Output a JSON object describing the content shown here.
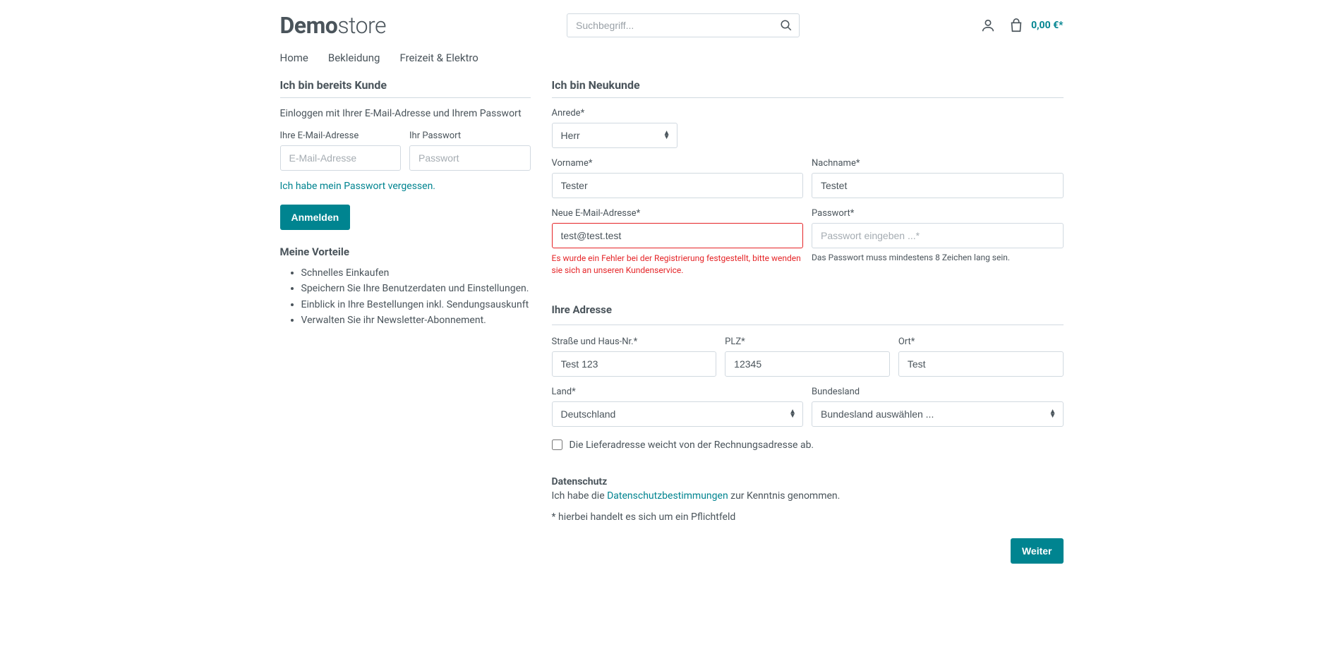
{
  "header": {
    "logo_bold": "Demo",
    "logo_light": "store",
    "search_placeholder": "Suchbegriff...",
    "cart_total": "0,00 €*"
  },
  "nav": {
    "items": [
      "Home",
      "Bekleidung",
      "Freizeit & Elektro"
    ]
  },
  "login": {
    "title": "Ich bin bereits Kunde",
    "desc": "Einloggen mit Ihrer E-Mail-Adresse und Ihrem Passwort",
    "email_label": "Ihre E-Mail-Adresse",
    "email_placeholder": "E-Mail-Adresse",
    "password_label": "Ihr Passwort",
    "password_placeholder": "Passwort",
    "forgot_link": "Ich habe mein Passwort vergessen.",
    "submit": "Anmelden"
  },
  "advantages": {
    "title": "Meine Vorteile",
    "items": [
      "Schnelles Einkaufen",
      "Speichern Sie Ihre Benutzerdaten und Einstellungen.",
      "Einblick in Ihre Bestellungen inkl. Sendungsauskunft",
      "Verwalten Sie ihr Newsletter-Abonnement."
    ]
  },
  "register": {
    "title": "Ich bin Neukunde",
    "salutation_label": "Anrede*",
    "salutation_value": "Herr",
    "firstname_label": "Vorname*",
    "firstname_value": "Tester",
    "lastname_label": "Nachname*",
    "lastname_value": "Testet",
    "email_label": "Neue E-Mail-Adresse*",
    "email_value": "test@test.test",
    "email_error": "Es wurde ein Fehler bei der Registrierung festgestellt, bitte wenden sie sich an unseren Kundenservice.",
    "password_label": "Passwort*",
    "password_placeholder": "Passwort eingeben ...*",
    "password_hint": "Das Passwort muss mindestens 8 Zeichen lang sein."
  },
  "address": {
    "title": "Ihre Adresse",
    "street_label": "Straße und Haus-Nr.*",
    "street_value": "Test 123",
    "zip_label": "PLZ*",
    "zip_value": "12345",
    "city_label": "Ort*",
    "city_value": "Test",
    "country_label": "Land*",
    "country_value": "Deutschland",
    "state_label": "Bundesland",
    "state_value": "Bundesland auswählen ...",
    "diff_shipping": "Die Lieferadresse weicht von der Rechnungsadresse ab."
  },
  "privacy": {
    "title": "Datenschutz",
    "text_pre": "Ich habe die ",
    "link": "Datenschutzbestimmungen",
    "text_post": " zur Kenntnis genommen."
  },
  "mandatory_note": "* hierbei handelt es sich um ein Pflichtfeld",
  "submit_button": "Weiter"
}
